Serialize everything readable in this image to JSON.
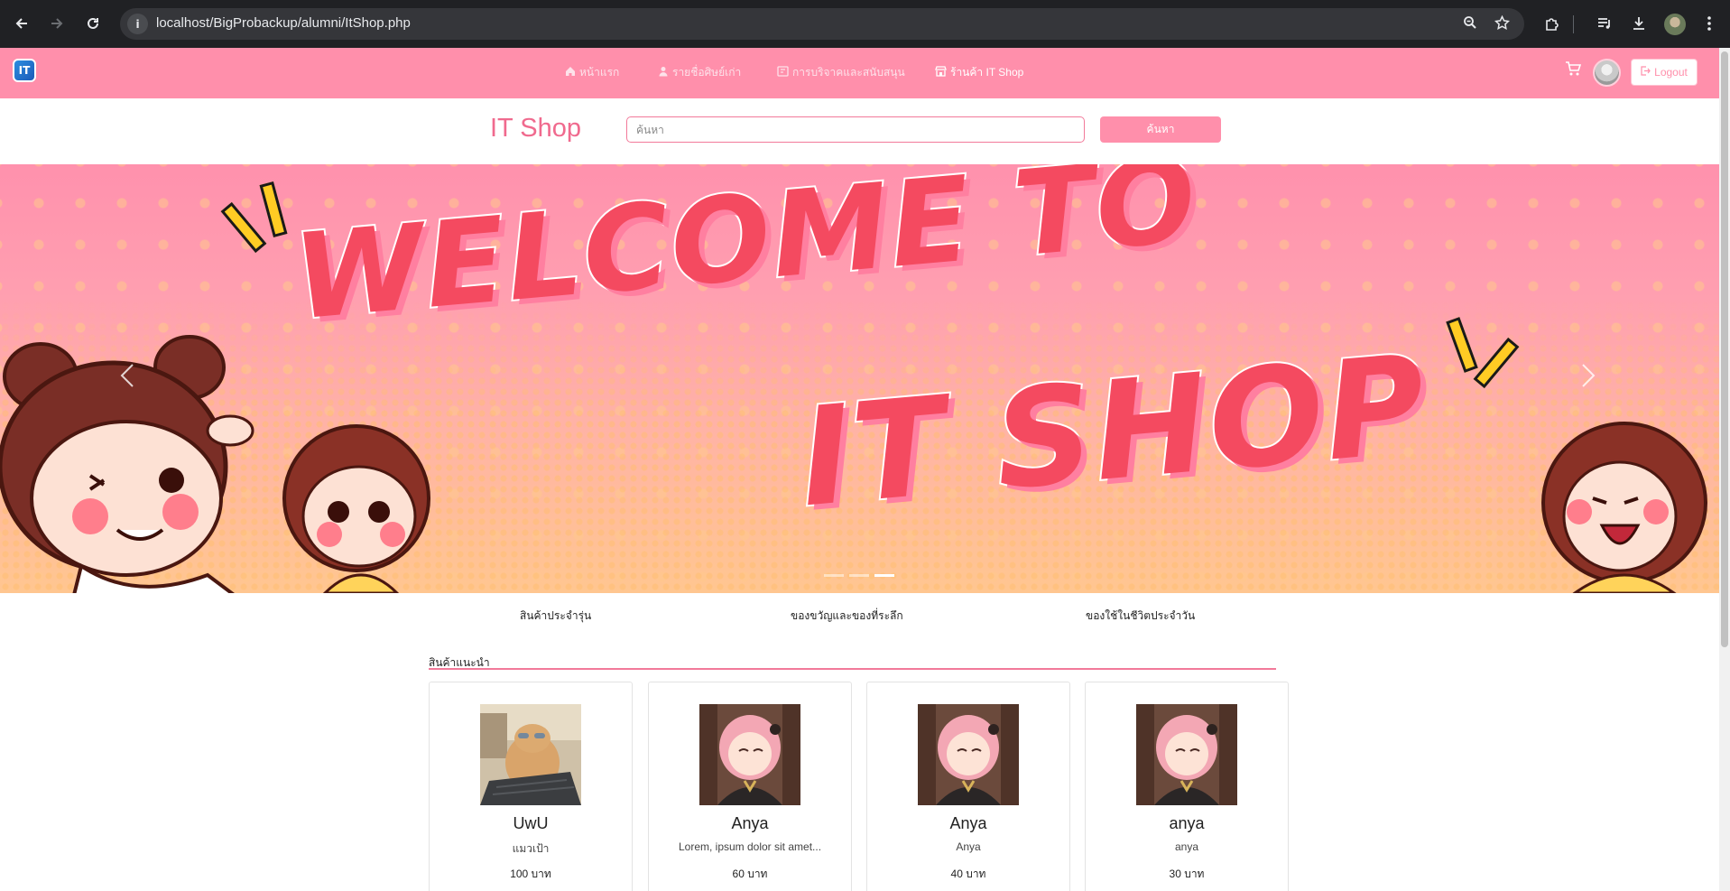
{
  "browser": {
    "url": "localhost/BigProbackup/alumni/ItShop.php"
  },
  "navbar": {
    "items": [
      {
        "label": "หน้าแรก",
        "icon": "home-icon"
      },
      {
        "label": "รายชื่อศิษย์เก่า",
        "icon": "user-icon"
      },
      {
        "label": "การบริจาคและสนับสนุน",
        "icon": "donate-icon"
      },
      {
        "label": "ร้านค้า IT Shop",
        "icon": "shop-icon"
      }
    ],
    "logout_label": "Logout"
  },
  "shop": {
    "title": "IT Shop",
    "search_placeholder": "ค้นหา",
    "search_button": "ค้นหา"
  },
  "banner": {
    "line1": "WELCOME TO",
    "line2": "IT SHOP",
    "slide_count": 3,
    "active_slide": 3
  },
  "categories": [
    "สินค้าประจำรุ่น",
    "ของขวัญและของที่ระลึก",
    "ของใช้ในชีวิตประจำวัน"
  ],
  "recommended": {
    "label": "สินค้าแนะนำ",
    "products": [
      {
        "name": "UwU",
        "desc": "แมวเป้า",
        "price": "100 บาท",
        "image": "cat"
      },
      {
        "name": "Anya",
        "desc": "Lorem, ipsum dolor sit amet...",
        "price": "60 บาท",
        "image": "anya"
      },
      {
        "name": "Anya",
        "desc": "Anya",
        "price": "40 บาท",
        "image": "anya"
      },
      {
        "name": "anya",
        "desc": "anya",
        "price": "30 บาท",
        "image": "anya"
      }
    ]
  },
  "colors": {
    "brand_pink": "#ff8fab",
    "title_pink": "#f06a8e",
    "banner_text": "#f44a60"
  }
}
